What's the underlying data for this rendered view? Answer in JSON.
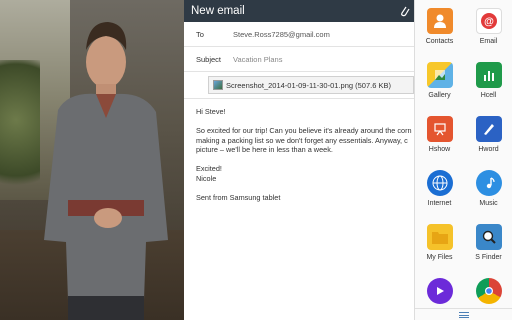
{
  "compose": {
    "title": "New email",
    "to_label": "To",
    "to_value": "Steve.Ross7285@gmail.com",
    "subject_label": "Subject",
    "subject_value": "Vacation Plans",
    "attachment": "Screenshot_2014-01-09-11-30-01.png (507.6 KB)",
    "body": {
      "greeting": "Hi Steve!",
      "line1": "So excited for our trip! Can you believe it's already around the corn",
      "line2": "making a packing list so we don't forget any essentials. Anyway, c",
      "line3": "picture – we'll be here in less than a week.",
      "closing1": "Excited!",
      "closing2": "Nicole",
      "signature": "Sent from Samsung tablet"
    }
  },
  "apps": [
    {
      "label": "Contacts",
      "icon": "contacts-icon"
    },
    {
      "label": "Email",
      "icon": "email-icon"
    },
    {
      "label": "Gallery",
      "icon": "gallery-icon"
    },
    {
      "label": "Hcell",
      "icon": "hcell-icon"
    },
    {
      "label": "Hshow",
      "icon": "hshow-icon"
    },
    {
      "label": "Hword",
      "icon": "hword-icon"
    },
    {
      "label": "Internet",
      "icon": "internet-icon"
    },
    {
      "label": "Music",
      "icon": "music-icon"
    },
    {
      "label": "My Files",
      "icon": "myfiles-icon"
    },
    {
      "label": "S Finder",
      "icon": "sfinder-icon"
    },
    {
      "label": "",
      "icon": "video-icon"
    },
    {
      "label": "",
      "icon": "chrome-icon"
    }
  ],
  "colors": {
    "header": "#2f3a45",
    "accent": "#4b7fb5"
  }
}
